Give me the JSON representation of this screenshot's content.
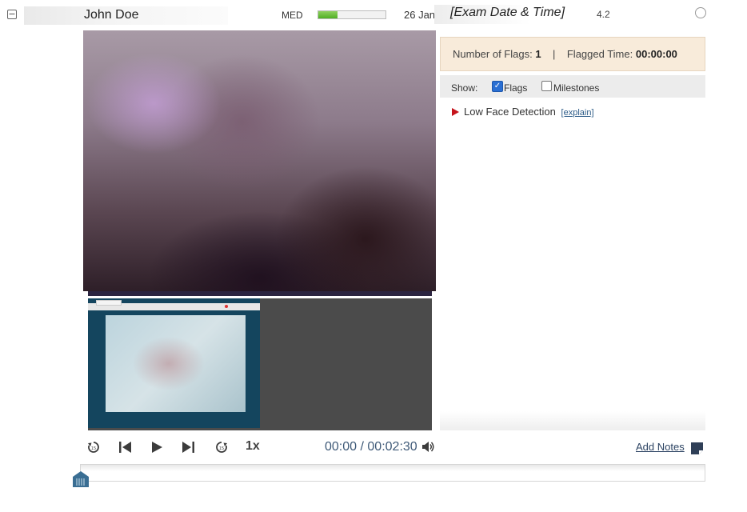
{
  "header": {
    "collapse_symbol": "−",
    "student_name": "John Doe",
    "risk_label": "MED",
    "risk_level_fraction": 0.28,
    "exam_date": "26 Jan",
    "exam_placeholder": "[Exam Date & Time]",
    "score": "4.2"
  },
  "flags_summary": {
    "count_label": "Number of Flags:",
    "count_value": "1",
    "separator": "|",
    "time_label": "Flagged Time:",
    "time_value": "00:00:00"
  },
  "filter": {
    "show_label": "Show:",
    "flags_label": "Flags",
    "flags_checked": true,
    "milestones_label": "Milestones",
    "milestones_checked": false
  },
  "flag_list": [
    {
      "label": "Low Face Detection",
      "link": "[explain]",
      "color": "#c5141c"
    }
  ],
  "controls": {
    "speed": "1x",
    "current_time": "00:00",
    "time_separator": "/",
    "total_time": "00:02:30",
    "add_notes": "Add Notes",
    "rewind_icon": "rewind-15-icon",
    "forward_icon": "forward-15-icon"
  },
  "colors": {
    "accent": "#2d4463",
    "flag_panel_bg": "#f8ebda",
    "risk_green": "#4fae24",
    "timeline_handle": "#3a6e93"
  }
}
